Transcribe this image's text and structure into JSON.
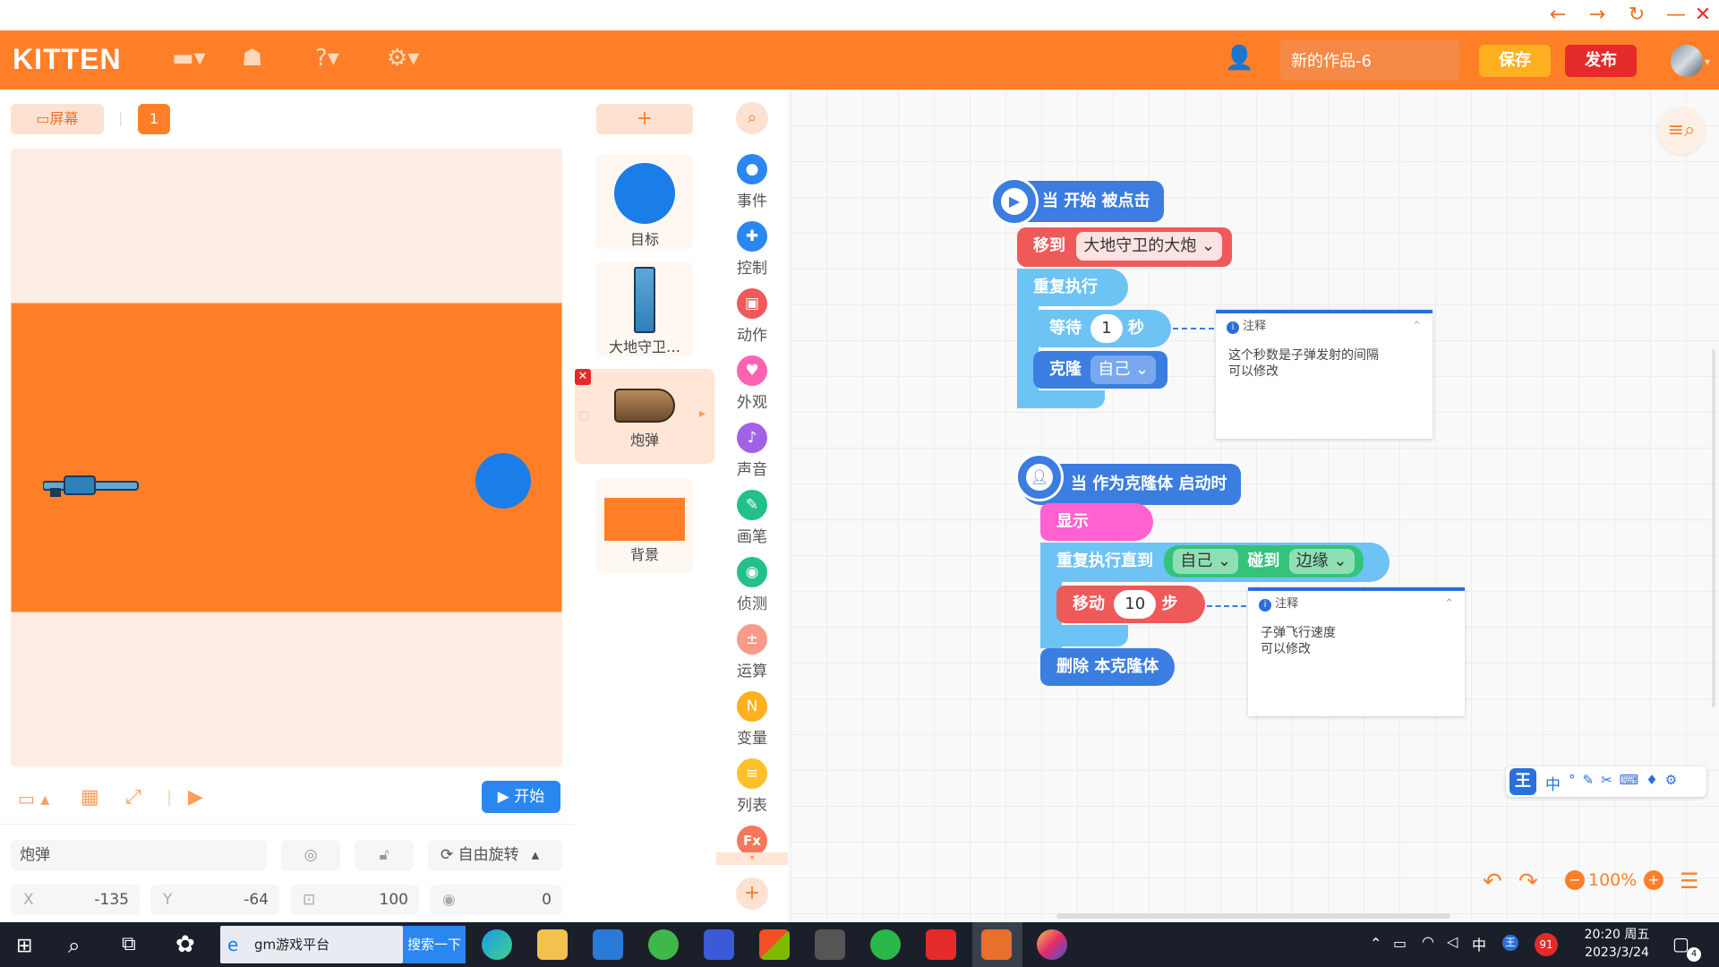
{
  "window": {
    "back": "←",
    "forward": "→",
    "reload": "↻",
    "minimize": "—",
    "close": "✕"
  },
  "topbar": {
    "logo": "KITTEN",
    "project_name": "新的作品-6",
    "save": "保存",
    "publish": "发布"
  },
  "stage": {
    "screen_btn": "屏幕",
    "scene_num": "1",
    "start_btn": "开始",
    "sprite_name": "炮弹",
    "rotation_mode": "自由旋转",
    "x_label": "X",
    "x": "-135",
    "y_label": "Y",
    "y": "-64",
    "size": "100",
    "direction": "0"
  },
  "sprites": {
    "add": "+",
    "items": [
      "目标",
      "大地守卫…",
      "炮弹",
      "背景"
    ]
  },
  "categories": [
    {
      "label": "事件",
      "color": "#2a87f0",
      "icon": "●"
    },
    {
      "label": "控制",
      "color": "#2a87f0",
      "icon": "✚"
    },
    {
      "label": "动作",
      "color": "#ee5a5a",
      "icon": "▣"
    },
    {
      "label": "外观",
      "color": "#ff62b0",
      "icon": "♥"
    },
    {
      "label": "声音",
      "color": "#a262e8",
      "icon": "♪"
    },
    {
      "label": "画笔",
      "color": "#23c08a",
      "icon": "✎"
    },
    {
      "label": "侦测",
      "color": "#23c08a",
      "icon": "◉"
    },
    {
      "label": "运算",
      "color": "#f99a8a",
      "icon": "±"
    },
    {
      "label": "变量",
      "color": "#ffb020",
      "icon": "N"
    },
    {
      "label": "列表",
      "color": "#ffc02a",
      "icon": "≡"
    }
  ],
  "category_fx": "Fx",
  "script1": {
    "hat": "当 开始 被点击",
    "move_to": "移到",
    "move_to_target": "大地守卫的大炮",
    "repeat": "重复执行",
    "wait": "等待",
    "wait_value": "1",
    "wait_unit": "秒",
    "clone": "克隆",
    "clone_target": "自己"
  },
  "note1": {
    "title": "注释",
    "line1": "这个秒数是子弹发射的间隔",
    "line2": "可以修改"
  },
  "script2": {
    "hat": "当 作为克隆体 启动时",
    "show": "显示",
    "repeat_until": "重复执行直到",
    "self": "自己",
    "touch": "碰到",
    "edge": "边缘",
    "move": "移动",
    "move_value": "10",
    "move_unit": "步",
    "delete_clone": "删除 本克隆体"
  },
  "note2": {
    "title": "注释",
    "line1": "子弹飞行速度",
    "line2": "可以修改"
  },
  "workspace": {
    "zoom": "100%"
  },
  "ime": {
    "cn": "中"
  },
  "taskbar": {
    "browser_tab": "gm游戏平台",
    "search_btn": "搜索一下",
    "tray_lang": "中",
    "badge": "91",
    "time": "20:20 周五",
    "date": "2023/3/24",
    "notif_count": "4"
  }
}
